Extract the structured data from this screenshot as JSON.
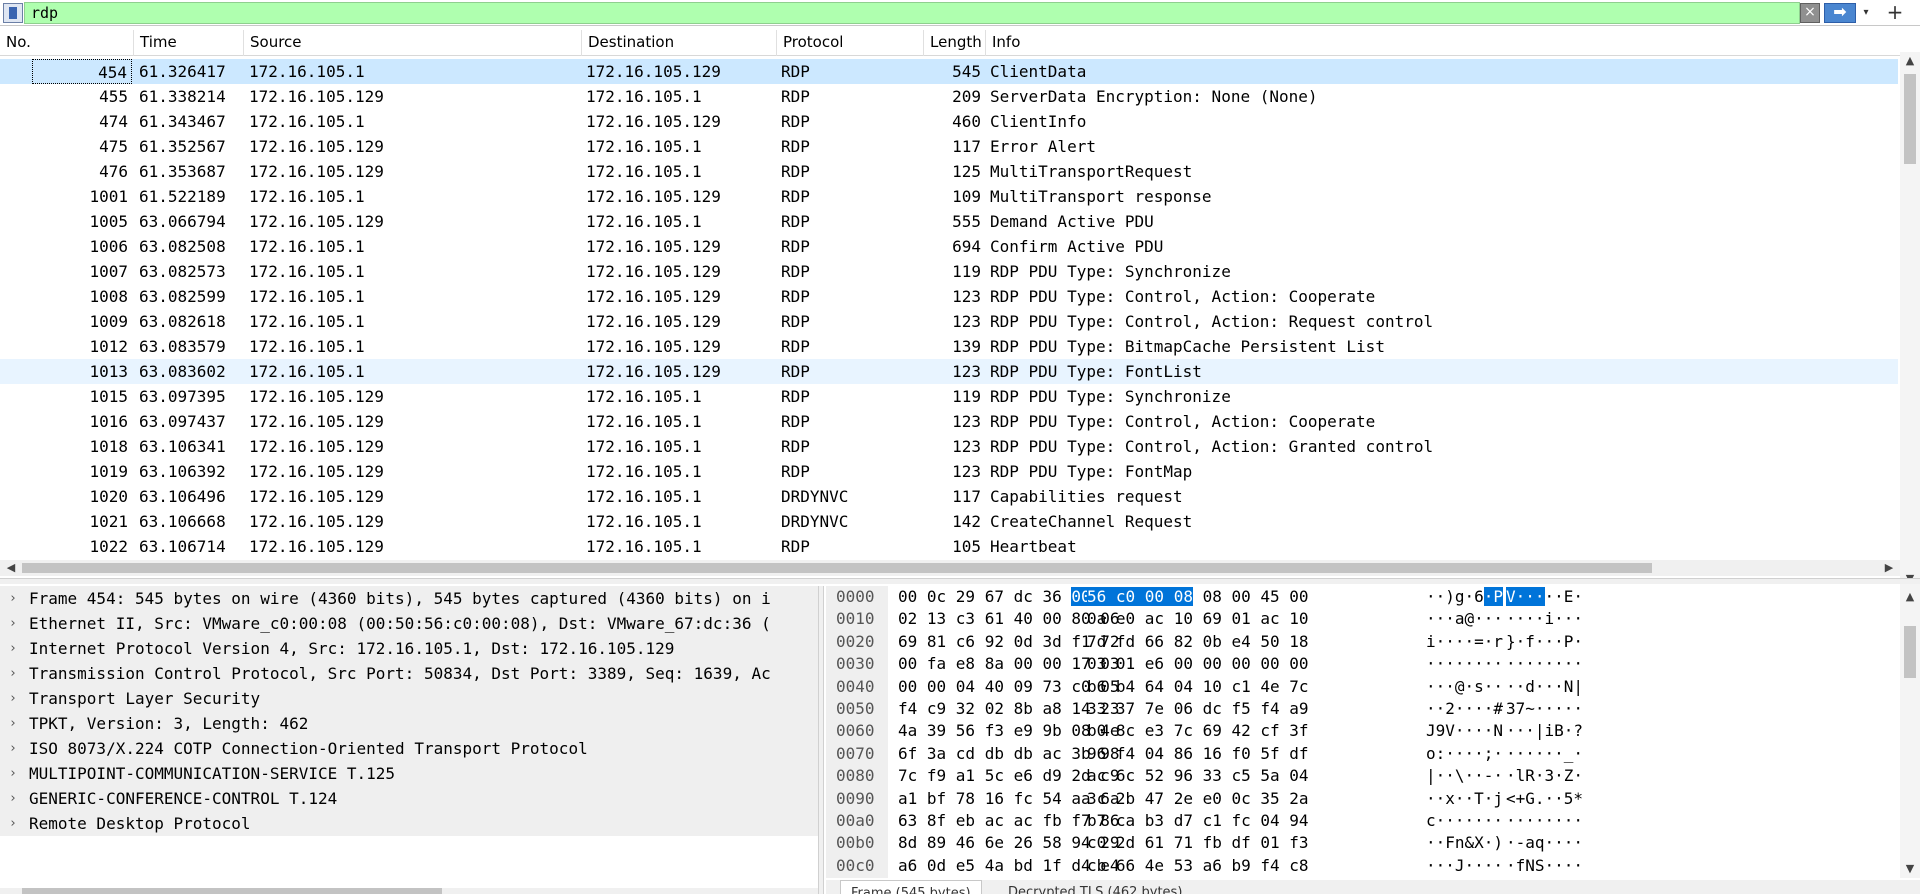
{
  "filter": {
    "value": "rdp",
    "clear_icon": "×",
    "apply_icon": "➡",
    "dropdown_icon": "▾",
    "add_icon": "+"
  },
  "colors": {
    "filter_valid_bg": "#afffaf",
    "selected_row": "#cce8ff",
    "alt_row": "#e8f4ff",
    "byte_highlight": "#0074d9"
  },
  "packet_list": {
    "columns": [
      "No.",
      "Time",
      "Source",
      "Destination",
      "Protocol",
      "Length",
      "Info"
    ],
    "rows": [
      {
        "no": "454",
        "time": "61.326417",
        "src": "172.16.105.1",
        "dst": "172.16.105.129",
        "proto": "RDP",
        "len": "545",
        "info": "ClientData"
      },
      {
        "no": "455",
        "time": "61.338214",
        "src": "172.16.105.129",
        "dst": "172.16.105.1",
        "proto": "RDP",
        "len": "209",
        "info": "ServerData Encryption: None (None)"
      },
      {
        "no": "474",
        "time": "61.343467",
        "src": "172.16.105.1",
        "dst": "172.16.105.129",
        "proto": "RDP",
        "len": "460",
        "info": "ClientInfo"
      },
      {
        "no": "475",
        "time": "61.352567",
        "src": "172.16.105.129",
        "dst": "172.16.105.1",
        "proto": "RDP",
        "len": "117",
        "info": "Error Alert"
      },
      {
        "no": "476",
        "time": "61.353687",
        "src": "172.16.105.129",
        "dst": "172.16.105.1",
        "proto": "RDP",
        "len": "125",
        "info": "MultiTransportRequest"
      },
      {
        "no": "1001",
        "time": "61.522189",
        "src": "172.16.105.1",
        "dst": "172.16.105.129",
        "proto": "RDP",
        "len": "109",
        "info": "MultiTransport response"
      },
      {
        "no": "1005",
        "time": "63.066794",
        "src": "172.16.105.129",
        "dst": "172.16.105.1",
        "proto": "RDP",
        "len": "555",
        "info": "Demand Active PDU"
      },
      {
        "no": "1006",
        "time": "63.082508",
        "src": "172.16.105.1",
        "dst": "172.16.105.129",
        "proto": "RDP",
        "len": "694",
        "info": "Confirm Active PDU"
      },
      {
        "no": "1007",
        "time": "63.082573",
        "src": "172.16.105.1",
        "dst": "172.16.105.129",
        "proto": "RDP",
        "len": "119",
        "info": "RDP PDU Type: Synchronize"
      },
      {
        "no": "1008",
        "time": "63.082599",
        "src": "172.16.105.1",
        "dst": "172.16.105.129",
        "proto": "RDP",
        "len": "123",
        "info": "RDP PDU Type: Control, Action: Cooperate"
      },
      {
        "no": "1009",
        "time": "63.082618",
        "src": "172.16.105.1",
        "dst": "172.16.105.129",
        "proto": "RDP",
        "len": "123",
        "info": "RDP PDU Type: Control, Action: Request control"
      },
      {
        "no": "1012",
        "time": "63.083579",
        "src": "172.16.105.1",
        "dst": "172.16.105.129",
        "proto": "RDP",
        "len": "139",
        "info": "RDP PDU Type: BitmapCache Persistent List"
      },
      {
        "no": "1013",
        "time": "63.083602",
        "src": "172.16.105.1",
        "dst": "172.16.105.129",
        "proto": "RDP",
        "len": "123",
        "info": "RDP PDU Type: FontList"
      },
      {
        "no": "1015",
        "time": "63.097395",
        "src": "172.16.105.129",
        "dst": "172.16.105.1",
        "proto": "RDP",
        "len": "119",
        "info": "RDP PDU Type: Synchronize"
      },
      {
        "no": "1016",
        "time": "63.097437",
        "src": "172.16.105.129",
        "dst": "172.16.105.1",
        "proto": "RDP",
        "len": "123",
        "info": "RDP PDU Type: Control, Action: Cooperate"
      },
      {
        "no": "1018",
        "time": "63.106341",
        "src": "172.16.105.129",
        "dst": "172.16.105.1",
        "proto": "RDP",
        "len": "123",
        "info": "RDP PDU Type: Control, Action: Granted control"
      },
      {
        "no": "1019",
        "time": "63.106392",
        "src": "172.16.105.129",
        "dst": "172.16.105.1",
        "proto": "RDP",
        "len": "123",
        "info": "RDP PDU Type: FontMap"
      },
      {
        "no": "1020",
        "time": "63.106496",
        "src": "172.16.105.129",
        "dst": "172.16.105.1",
        "proto": "DRDYNVC",
        "len": "117",
        "info": "Capabilities request"
      },
      {
        "no": "1021",
        "time": "63.106668",
        "src": "172.16.105.129",
        "dst": "172.16.105.1",
        "proto": "DRDYNVC",
        "len": "142",
        "info": "CreateChannel Request"
      },
      {
        "no": "1022",
        "time": "63.106714",
        "src": "172.16.105.129",
        "dst": "172.16.105.1",
        "proto": "RDP",
        "len": "105",
        "info": "Heartbeat"
      }
    ]
  },
  "details": [
    "Frame 454: 545 bytes on wire (4360 bits), 545 bytes captured (4360 bits) on i",
    "Ethernet II, Src: VMware_c0:00:08 (00:50:56:c0:00:08), Dst: VMware_67:dc:36 (",
    "Internet Protocol Version 4, Src: 172.16.105.1, Dst: 172.16.105.129",
    "Transmission Control Protocol, Src Port: 50834, Dst Port: 3389, Seq: 1639, Ac",
    "Transport Layer Security",
    "TPKT, Version: 3, Length: 462",
    "ISO 8073/X.224 COTP Connection-Oriented Transport Protocol",
    "MULTIPOINT-COMMUNICATION-SERVICE T.125",
    "GENERIC-CONFERENCE-CONTROL T.124",
    "Remote Desktop Protocol"
  ],
  "bytes": [
    {
      "off": "0000",
      "hex1": "00 0c 29 67 dc 36",
      "hl1": "00 50",
      "hex2a": "",
      "hl2": "56 c0 00 08",
      "hex2b": " 08 00 45 00",
      "asc1a": "··)g·6",
      "asc1hl": "·P",
      "asc2hl": "V···",
      "asc2b": "··E·"
    },
    {
      "off": "0010",
      "hex1": "02 13 c3 61 40 00 80 06",
      "hl1": "",
      "hex2a": "0a e0 ac 10 69 01 ac 10",
      "hl2": "",
      "hex2b": "",
      "asc1a": "···a@···",
      "asc1hl": "",
      "asc2hl": "",
      "asc2b": "····i···"
    },
    {
      "off": "0020",
      "hex1": "69 81 c6 92 0d 3d f1 72",
      "hl1": "",
      "hex2a": "7d fd 66 82 0b e4 50 18",
      "hl2": "",
      "hex2b": "",
      "asc1a": "i····=·r",
      "asc1hl": "",
      "asc2hl": "",
      "asc2b": "}·f···P·"
    },
    {
      "off": "0030",
      "hex1": "00 fa e8 8a 00 00 17 03",
      "hl1": "",
      "hex2a": "03 01 e6 00 00 00 00 00",
      "hl2": "",
      "hex2b": "",
      "asc1a": "········",
      "asc1hl": "",
      "asc2hl": "",
      "asc2b": "········"
    },
    {
      "off": "0040",
      "hex1": "00 00 04 40 09 73 c0 05",
      "hl1": "",
      "hex2a": "b6 b4 64 04 10 c1 4e 7c",
      "hl2": "",
      "hex2b": "",
      "asc1a": "···@·s··",
      "asc1hl": "",
      "asc2hl": "",
      "asc2b": "··d···N|"
    },
    {
      "off": "0050",
      "hex1": "f4 c9 32 02 8b a8 14 23",
      "hl1": "",
      "hex2a": "33 37 7e 06 dc f5 f4 a9",
      "hl2": "",
      "hex2b": "",
      "asc1a": "··2····#",
      "asc1hl": "",
      "asc2hl": "",
      "asc2b": "37~·····"
    },
    {
      "off": "0060",
      "hex1": "4a 39 56 f3 e9 9b 08 4e",
      "hl1": "",
      "hex2a": "b0 8c e3 7c 69 42 cf 3f",
      "hl2": "",
      "hex2b": "",
      "asc1a": "J9V····N",
      "asc1hl": "",
      "asc2hl": "",
      "asc2b": "···|iB·?"
    },
    {
      "off": "0070",
      "hex1": "6f 3a cd db db ac 3b 98",
      "hl1": "",
      "hex2a": "96 f4 04 86 16 f0 5f df",
      "hl2": "",
      "hex2b": "",
      "asc1a": "o:····;·",
      "asc1hl": "",
      "asc2hl": "",
      "asc2b": "······_·"
    },
    {
      "off": "0080",
      "hex1": "7c f9 a1 5c e6 d9 2d c9",
      "hl1": "",
      "hex2a": "ac 6c 52 96 33 c5 5a 04",
      "hl2": "",
      "hex2b": "",
      "asc1a": "|··\\··-·",
      "asc1hl": "",
      "asc2hl": "",
      "asc2b": "·lR·3·Z·"
    },
    {
      "off": "0090",
      "hex1": "a1 bf 78 16 fc 54 aa 6a",
      "hl1": "",
      "hex2a": "3c 2b 47 2e e0 0c 35 2a",
      "hl2": "",
      "hex2b": "",
      "asc1a": "··x··T·j",
      "asc1hl": "",
      "asc2hl": "",
      "asc2b": "<+G.··5*"
    },
    {
      "off": "00a0",
      "hex1": "63 8f eb ac ac fb f7 86",
      "hl1": "",
      "hex2a": "b7 ca b3 d7 c1 fc 04 94",
      "hl2": "",
      "hex2b": "",
      "asc1a": "c·······",
      "asc1hl": "",
      "asc2hl": "",
      "asc2b": "········"
    },
    {
      "off": "00b0",
      "hex1": "8d 89 46 6e 26 58 94 29",
      "hl1": "",
      "hex2a": "c0 2d 61 71 fb df 01 f3",
      "hl2": "",
      "hex2b": "",
      "asc1a": "··Fn&X·)",
      "asc1hl": "",
      "asc2hl": "",
      "asc2b": "·-aq····"
    },
    {
      "off": "00c0",
      "hex1": "a6 0d e5 4a bd 1f d4 e4",
      "hl1": "",
      "hex2a": "cb 66 4e 53 a6 b9 f4 c8",
      "hl2": "",
      "hex2b": "",
      "asc1a": "···J····",
      "asc1hl": "",
      "asc2hl": "",
      "asc2b": "·fNS····"
    }
  ],
  "bytes_tabs": {
    "frame": "Frame (545 bytes)",
    "tls": "Decrypted TLS (462 bytes)"
  }
}
